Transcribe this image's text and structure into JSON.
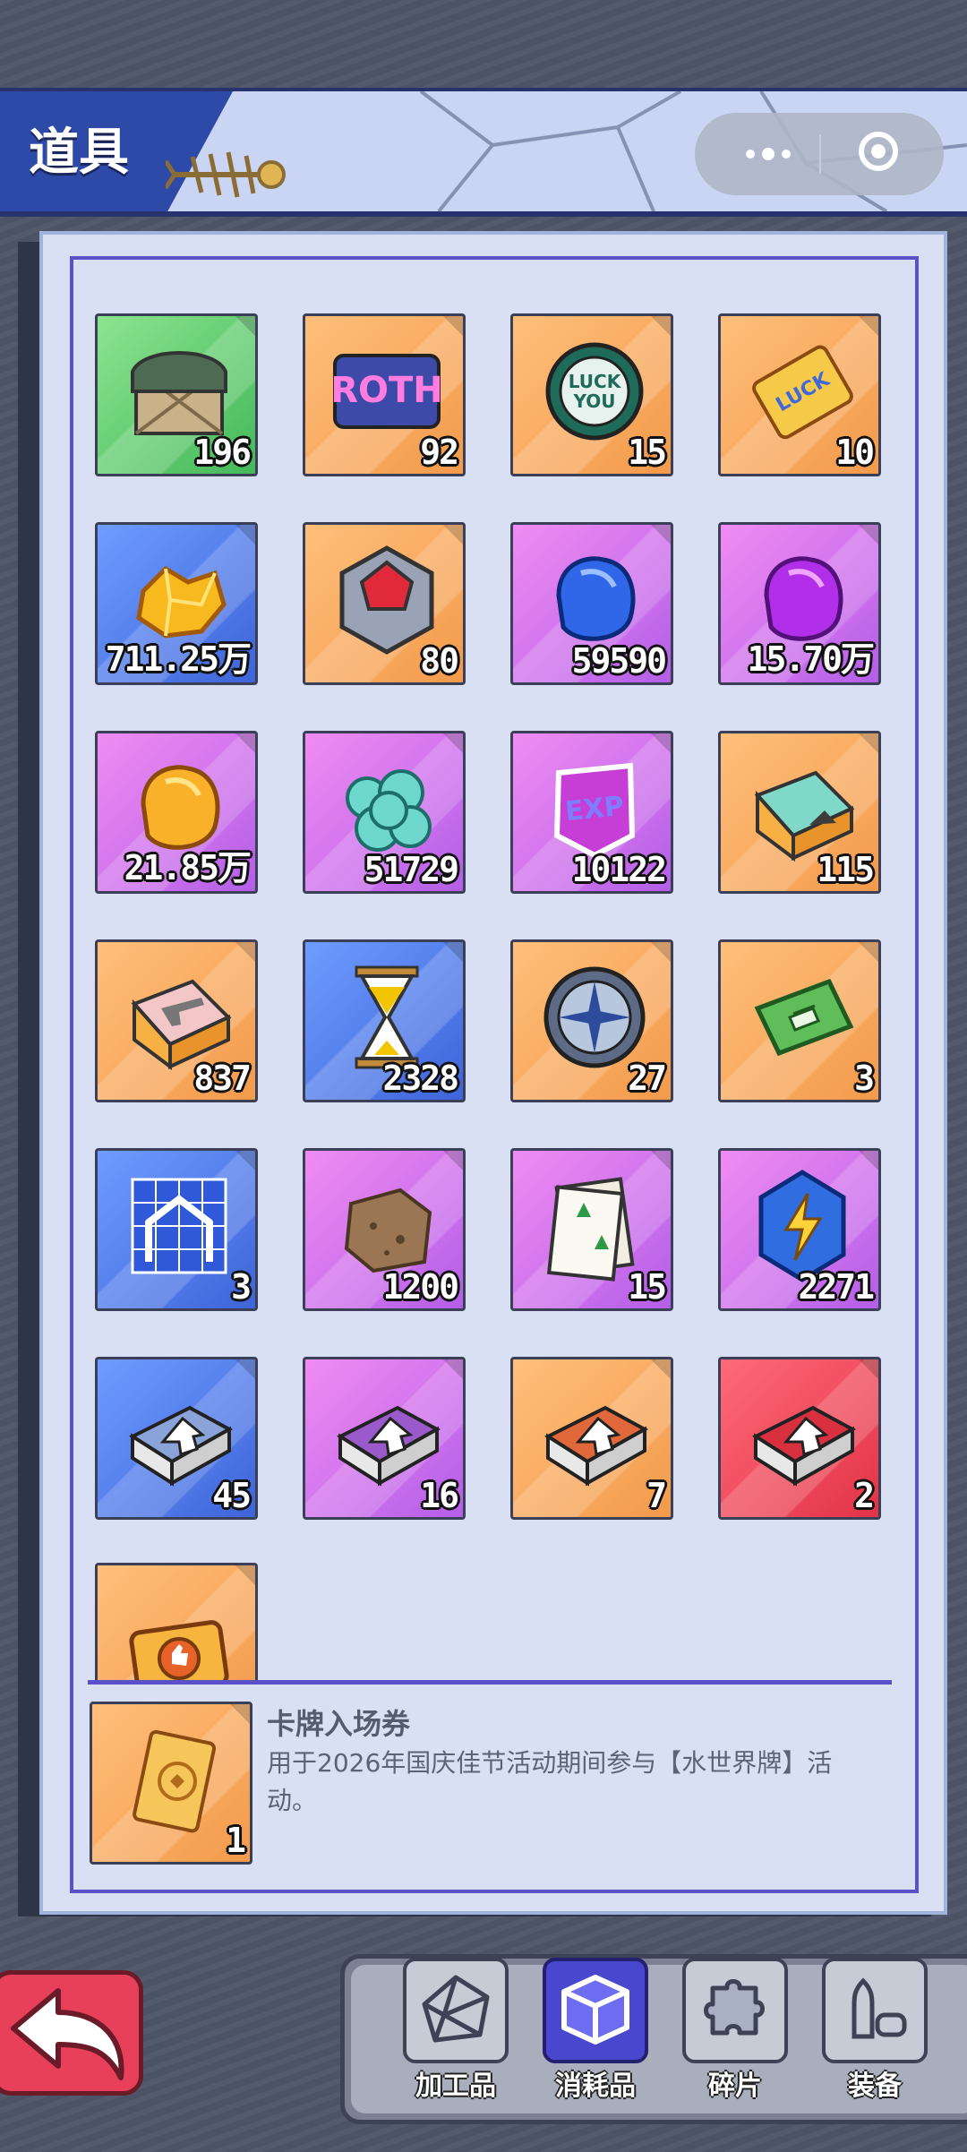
{
  "header": {
    "title": "道具"
  },
  "items": [
    {
      "icon": "supply-crate-icon",
      "color": "green",
      "qty": "196"
    },
    {
      "icon": "roth-card-icon",
      "color": "orange",
      "qty": "92"
    },
    {
      "icon": "luck-coin-icon",
      "color": "orange",
      "qty": "15"
    },
    {
      "icon": "good-luck-ticket-icon",
      "color": "orange",
      "qty": "10"
    },
    {
      "icon": "gold-ore-icon",
      "color": "blue",
      "qty": "711.25万"
    },
    {
      "icon": "red-gem-badge-icon",
      "color": "orange",
      "qty": "80"
    },
    {
      "icon": "blue-crystal-icon",
      "color": "purple",
      "qty": "59590"
    },
    {
      "icon": "purple-crystal-icon",
      "color": "purple",
      "qty": "15.70万"
    },
    {
      "icon": "gold-crystal-icon",
      "color": "purple",
      "qty": "21.85万"
    },
    {
      "icon": "teal-ore-cluster-icon",
      "color": "purple",
      "qty": "51729"
    },
    {
      "icon": "exp-card-icon",
      "color": "purple",
      "qty": "10122"
    },
    {
      "icon": "shark-box-icon",
      "color": "orange",
      "qty": "115"
    },
    {
      "icon": "gun-box-icon",
      "color": "orange",
      "qty": "837"
    },
    {
      "icon": "hourglass-icon",
      "color": "blue",
      "qty": "2328"
    },
    {
      "icon": "compass-icon",
      "color": "orange",
      "qty": "27"
    },
    {
      "icon": "bank-cash-icon",
      "color": "orange",
      "qty": "3"
    },
    {
      "icon": "blueprint-house-icon",
      "color": "blue",
      "qty": "3"
    },
    {
      "icon": "dirt-block-icon",
      "color": "purple",
      "qty": "1200"
    },
    {
      "icon": "tree-documents-icon",
      "color": "purple",
      "qty": "15"
    },
    {
      "icon": "energy-gem-icon",
      "color": "purple",
      "qty": "2271"
    },
    {
      "icon": "upgrade-book-blue-icon",
      "color": "blue",
      "qty": "45"
    },
    {
      "icon": "upgrade-book-purple-icon",
      "color": "purple",
      "qty": "16"
    },
    {
      "icon": "upgrade-book-orange-icon",
      "color": "orange",
      "qty": "7"
    },
    {
      "icon": "upgrade-book-red-icon",
      "color": "red",
      "qty": "2"
    }
  ],
  "partial_item": {
    "icon": "thumbs-up-ticket-icon",
    "color": "orange"
  },
  "selected": {
    "icon": "card-ticket-icon",
    "qty": "1",
    "name": "卡牌入场券",
    "description": "用于2026年国庆佳节活动期间参与【水世界牌】活动。"
  },
  "tabs": [
    {
      "label": "加工品",
      "icon": "polyhedron-icon",
      "active": false
    },
    {
      "label": "消耗品",
      "icon": "cube-icon",
      "active": true
    },
    {
      "label": "碎片",
      "icon": "puzzle-piece-icon",
      "active": false
    },
    {
      "label": "装备",
      "icon": "bullets-icon",
      "active": false
    }
  ],
  "colors": {
    "green": "#5ccf6c",
    "orange": "#f7a85c",
    "blue": "#4f78ea",
    "purple": "#d075ee",
    "red": "#f04a5c",
    "accent": "#5a51c9"
  }
}
